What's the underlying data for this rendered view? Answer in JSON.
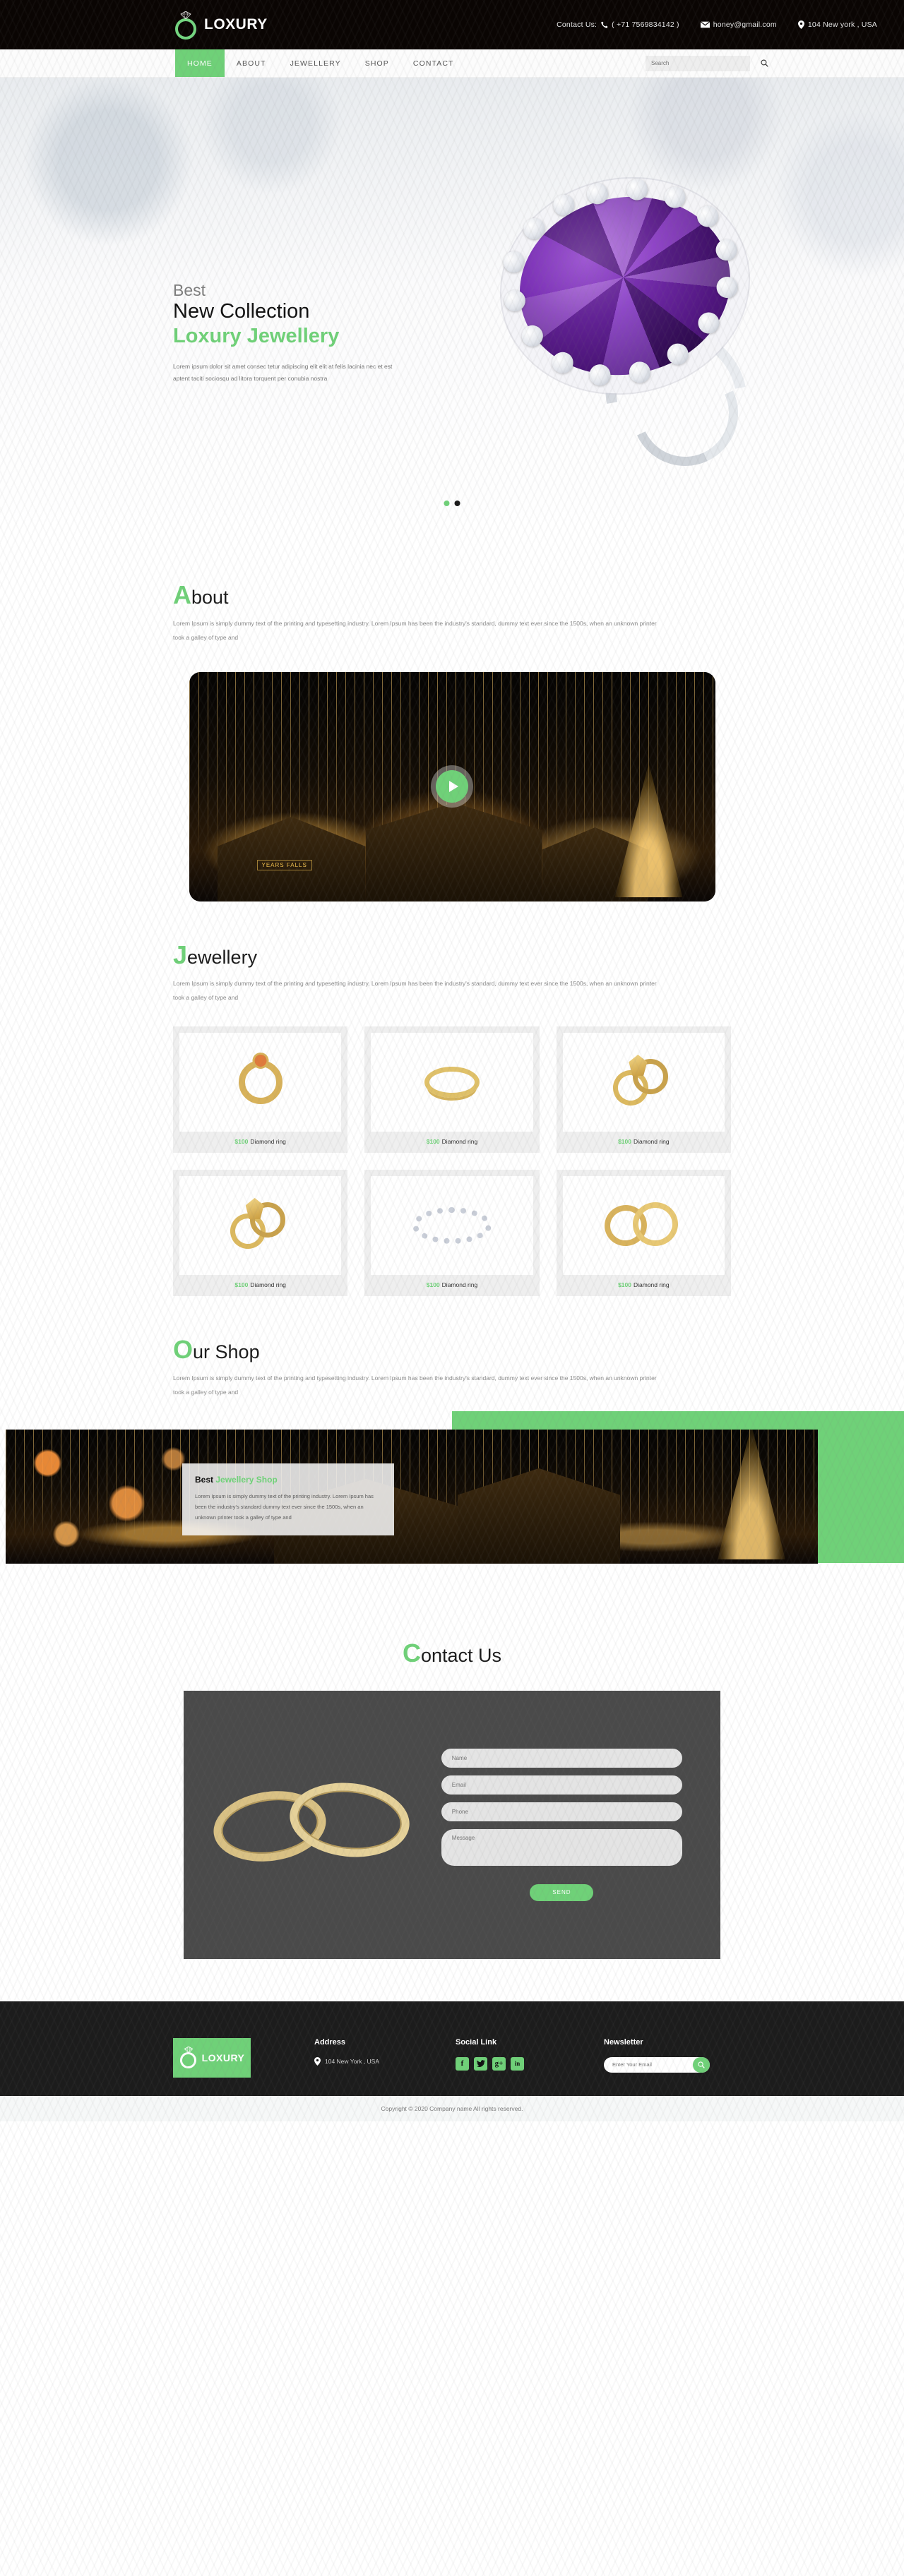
{
  "topbar": {
    "brand": "LOXURY",
    "logo_icon": "diamond-ring-icon",
    "contact_label": "Contact Us:",
    "phone": "( +71 7569834142 )",
    "email": "honey@gmail.com",
    "address": "104 New york , USA",
    "phone_icon": "phone-icon",
    "email_icon": "envelope-icon",
    "location_icon": "map-pin-icon"
  },
  "nav": {
    "items": [
      {
        "label": "HOME",
        "active": true
      },
      {
        "label": "ABOUT",
        "active": false
      },
      {
        "label": "JEWELLERY",
        "active": false
      },
      {
        "label": "SHOP",
        "active": false
      },
      {
        "label": "CONTACT",
        "active": false
      }
    ],
    "search_placeholder": "Search",
    "search_icon": "search-icon"
  },
  "hero": {
    "eyebrow": "Best",
    "title": "New Collection",
    "subtitle": "Loxury Jewellery",
    "paragraph": "Lorem ipsum dolor sit amet consec tetur adipiscing elit elit at felis lacinia nec et est aptent taciti sociosqu ad litora torquent per conubia nostra",
    "slider_dots": 2,
    "active_dot": 0
  },
  "about": {
    "title_cap": "A",
    "title_rest": "bout",
    "paragraph": "Lorem Ipsum is simply dummy text of the printing and typesetting industry. Lorem Ipsum has been the industry's standard, dummy text ever since the 1500s, when an unknown printer took a galley of type and",
    "play_icon": "play-icon",
    "video_caption": "YEARS FALLS"
  },
  "jewellery": {
    "title_cap": "J",
    "title_rest": "ewellery",
    "paragraph": "Lorem Ipsum is simply dummy text of the printing and typesetting industry. Lorem Ipsum has been the industry's standard, dummy text ever since the 1500s, when an unknown printer took a galley of type and",
    "products": [
      {
        "price": "$100",
        "name": "Diamond ring",
        "shape": "ring-gemstone"
      },
      {
        "price": "$100",
        "name": "Diamond ring",
        "shape": "ring-band"
      },
      {
        "price": "$100",
        "name": "Diamond ring",
        "shape": "ring-pair-gem"
      },
      {
        "price": "$100",
        "name": "Diamond ring",
        "shape": "ring-pair-gem"
      },
      {
        "price": "$100",
        "name": "Diamond ring",
        "shape": "tennis-bracelet"
      },
      {
        "price": "$100",
        "name": "Diamond ring",
        "shape": "two-gold-rings"
      }
    ]
  },
  "shop": {
    "title_cap": "O",
    "title_rest": "ur Shop",
    "paragraph": "Lorem Ipsum is simply dummy text of the printing and typesetting industry. Lorem Ipsum has been the industry's standard, dummy text ever since the 1500s, when an unknown printer took a galley of type and",
    "overlay_title_dark": "Best",
    "overlay_title_green": "Jewellery Shop",
    "overlay_paragraph": "Lorem Ipsum is simply dummy text of the printing industry. Lorem Ipsum has been the industry's standard dummy text ever since the 1500s, when an unknown printer took a galley of type and"
  },
  "contact": {
    "title_cap": "C",
    "title_rest": "ontact Us",
    "fields": [
      {
        "placeholder": "Name",
        "type": "text",
        "value": ""
      },
      {
        "placeholder": "Email",
        "type": "text",
        "value": ""
      },
      {
        "placeholder": "Phone",
        "type": "text",
        "value": ""
      }
    ],
    "message_placeholder": "Message",
    "message_value": "",
    "send_label": "SEND"
  },
  "footer": {
    "brand": "LOXURY",
    "address_heading": "Address",
    "address": "104 New York , USA",
    "social_heading": "Social Link",
    "socials": [
      {
        "name": "facebook-icon",
        "glyph": "f"
      },
      {
        "name": "twitter-icon",
        "glyph": "ᴠ"
      },
      {
        "name": "google-plus-icon",
        "glyph": "g+"
      },
      {
        "name": "linkedin-icon",
        "glyph": "in"
      }
    ],
    "newsletter_heading": "Newsletter",
    "newsletter_placeholder": "Enter Your Email",
    "newsletter_icon": "search-icon",
    "copyright": "Copyright © 2020 Company name All rights reserved."
  },
  "colors": {
    "accent_green": "#6fd178",
    "dark_bar": "#0a0503",
    "footer_bg": "#1c1c1c",
    "contact_card": "#4a4a4a"
  }
}
